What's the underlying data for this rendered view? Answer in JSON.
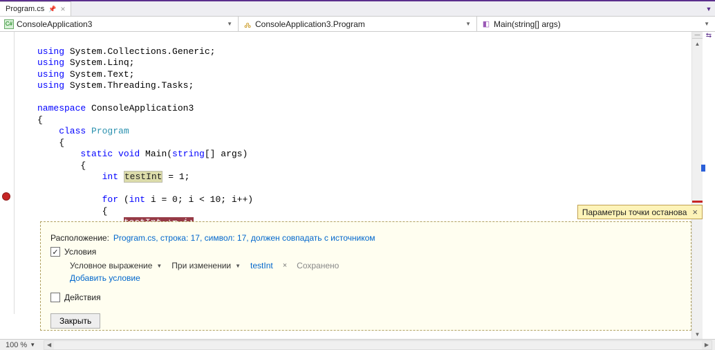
{
  "tab": {
    "filename": "Program.cs"
  },
  "nav": {
    "scope": "ConsoleApplication3",
    "class": "ConsoleApplication3.Program",
    "method": "Main(string[] args)"
  },
  "code": {
    "l1": "using",
    "l1b": " System.Collections.Generic;",
    "l2": "using",
    "l2b": " System.Linq;",
    "l3": "using",
    "l3b": " System.Text;",
    "l4": "using",
    "l4b": " System.Threading.Tasks;",
    "ns": "namespace",
    "nsName": " ConsoleApplication3",
    "ob": "{",
    "cls": "    class",
    "clsName": " Program",
    "ob2": "    {",
    "stat": "        static",
    "void": " void",
    "main": " Main(",
    "strT": "string",
    "mainR": "[] args)",
    "ob3": "        {",
    "intT": "            int",
    "ti": "testInt",
    "tiR": " = 1;",
    "forK": "            for",
    "forP1": " (",
    "forInt": "int",
    "forBody": " i = 0; i < 10; i++)",
    "ob4": "            {",
    "bpTok": "testInt += i;",
    "bpIndent": "                "
  },
  "banner": {
    "text": "Параметры точки останова"
  },
  "panel": {
    "loc_label": "Расположение:",
    "loc_link": "Program.cs, строка: 17, символ: 17, должен совпадать с источником",
    "conditions": "Условия",
    "cond_type": "Условное выражение",
    "cond_mode": "При изменении",
    "cond_value": "testInt",
    "saved": "Сохранено",
    "add_condition": "Добавить условие",
    "actions": "Действия",
    "close": "Закрыть"
  },
  "status": {
    "zoom": "100 %"
  }
}
